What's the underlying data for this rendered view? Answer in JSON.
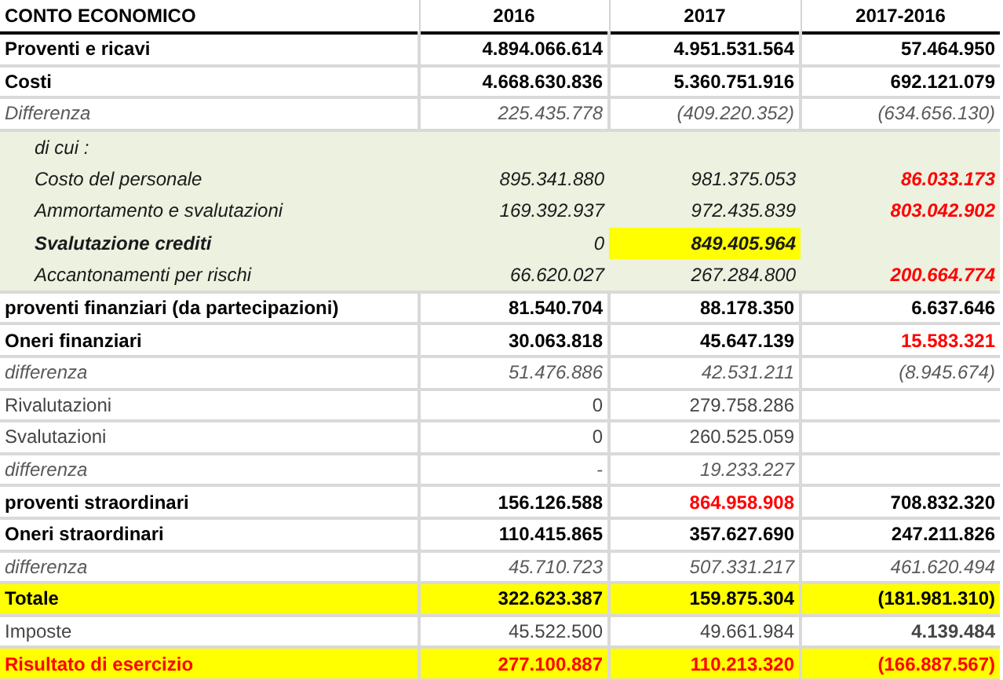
{
  "columns": [
    {
      "text": "CONTO ECONOMICO"
    },
    {
      "text": "2016"
    },
    {
      "text": "2017"
    },
    {
      "text": "2017-2016"
    }
  ],
  "rows": [
    {
      "kind": "main",
      "cells": [
        {
          "text": "Proventi e ricavi",
          "bold": true,
          "flagged": false,
          "highlighted": false
        },
        {
          "text": "4.894.066.614",
          "bold": true,
          "flagged": false,
          "highlighted": false
        },
        {
          "text": "4.951.531.564",
          "bold": true,
          "flagged": false,
          "highlighted": false
        },
        {
          "text": "57.464.950",
          "bold": true,
          "flagged": false,
          "highlighted": false
        }
      ]
    },
    {
      "kind": "main",
      "cells": [
        {
          "text": "Costi",
          "bold": true,
          "flagged": false,
          "highlighted": false
        },
        {
          "text": "4.668.630.836",
          "bold": true,
          "flagged": false,
          "highlighted": false
        },
        {
          "text": "5.360.751.916",
          "bold": true,
          "flagged": false,
          "highlighted": false
        },
        {
          "text": "692.121.079",
          "bold": true,
          "flagged": false,
          "highlighted": false
        }
      ]
    },
    {
      "kind": "diff",
      "cells": [
        {
          "text": "Differenza",
          "bold": false,
          "flagged": false,
          "highlighted": false
        },
        {
          "text": "225.435.778",
          "bold": false,
          "flagged": false,
          "highlighted": false
        },
        {
          "text": "(409.220.352)",
          "bold": false,
          "flagged": false,
          "highlighted": false
        },
        {
          "text": "(634.656.130)",
          "bold": false,
          "flagged": false,
          "highlighted": false
        }
      ]
    },
    {
      "kind": "sub",
      "cells": [
        {
          "text": "di cui :",
          "bold": false,
          "flagged": false,
          "highlighted": false
        },
        null,
        null,
        null
      ]
    },
    {
      "kind": "sub",
      "cells": [
        {
          "text": "Costo del personale",
          "bold": false,
          "flagged": false,
          "highlighted": false
        },
        {
          "text": "895.341.880",
          "bold": false,
          "flagged": false,
          "highlighted": false
        },
        {
          "text": "981.375.053",
          "bold": false,
          "flagged": false,
          "highlighted": false
        },
        {
          "text": "86.033.173",
          "bold": true,
          "flagged": true,
          "highlighted": false
        }
      ]
    },
    {
      "kind": "sub",
      "cells": [
        {
          "text": "Ammortamento e svalutazioni",
          "bold": false,
          "flagged": false,
          "highlighted": false
        },
        {
          "text": "169.392.937",
          "bold": false,
          "flagged": false,
          "highlighted": false
        },
        {
          "text": "972.435.839",
          "bold": false,
          "flagged": false,
          "highlighted": false
        },
        {
          "text": "803.042.902",
          "bold": true,
          "flagged": true,
          "highlighted": false
        }
      ]
    },
    {
      "kind": "sub",
      "cells": [
        {
          "text": "Svalutazione crediti",
          "bold": true,
          "flagged": false,
          "highlighted": false
        },
        {
          "text": "0",
          "bold": false,
          "flagged": false,
          "highlighted": false
        },
        {
          "text": "849.405.964",
          "bold": true,
          "flagged": false,
          "highlighted": true
        },
        null
      ]
    },
    {
      "kind": "sub",
      "cells": [
        {
          "text": "Accantonamenti per rischi",
          "bold": false,
          "flagged": false,
          "highlighted": false
        },
        {
          "text": "66.620.027",
          "bold": false,
          "flagged": false,
          "highlighted": false
        },
        {
          "text": "267.284.800",
          "bold": false,
          "flagged": false,
          "highlighted": false
        },
        {
          "text": "200.664.774",
          "bold": true,
          "flagged": true,
          "highlighted": false
        }
      ]
    },
    {
      "kind": "main",
      "cells": [
        {
          "text": "proventi finanziari (da partecipazioni)",
          "bold": true,
          "flagged": false,
          "highlighted": false
        },
        {
          "text": "81.540.704",
          "bold": true,
          "flagged": false,
          "highlighted": false
        },
        {
          "text": "88.178.350",
          "bold": true,
          "flagged": false,
          "highlighted": false
        },
        {
          "text": "6.637.646",
          "bold": true,
          "flagged": false,
          "highlighted": false
        }
      ]
    },
    {
      "kind": "main",
      "cells": [
        {
          "text": "Oneri finanziari",
          "bold": true,
          "flagged": false,
          "highlighted": false
        },
        {
          "text": "30.063.818",
          "bold": true,
          "flagged": false,
          "highlighted": false
        },
        {
          "text": "45.647.139",
          "bold": true,
          "flagged": false,
          "highlighted": false
        },
        {
          "text": "15.583.321",
          "bold": true,
          "flagged": true,
          "highlighted": false
        }
      ]
    },
    {
      "kind": "diff",
      "cells": [
        {
          "text": "differenza",
          "bold": false,
          "flagged": false,
          "highlighted": false
        },
        {
          "text": "51.476.886",
          "bold": false,
          "flagged": false,
          "highlighted": false
        },
        {
          "text": "42.531.211",
          "bold": false,
          "flagged": false,
          "highlighted": false
        },
        {
          "text": "(8.945.674)",
          "bold": false,
          "flagged": false,
          "highlighted": false
        }
      ]
    },
    {
      "kind": "plain",
      "cells": [
        {
          "text": "Rivalutazioni",
          "bold": false,
          "flagged": false,
          "highlighted": false
        },
        {
          "text": "0",
          "bold": false,
          "flagged": false,
          "highlighted": false
        },
        {
          "text": "279.758.286",
          "bold": false,
          "flagged": false,
          "highlighted": false
        },
        null
      ]
    },
    {
      "kind": "plain",
      "cells": [
        {
          "text": "Svalutazioni",
          "bold": false,
          "flagged": false,
          "highlighted": false
        },
        {
          "text": "0",
          "bold": false,
          "flagged": false,
          "highlighted": false
        },
        {
          "text": "260.525.059",
          "bold": false,
          "flagged": false,
          "highlighted": false
        },
        null
      ]
    },
    {
      "kind": "diff",
      "cells": [
        {
          "text": "differenza",
          "bold": false,
          "flagged": false,
          "highlighted": false
        },
        {
          "text": "-",
          "bold": false,
          "flagged": false,
          "highlighted": false
        },
        {
          "text": "19.233.227",
          "bold": false,
          "flagged": false,
          "highlighted": false
        },
        null
      ]
    },
    {
      "kind": "main",
      "cells": [
        {
          "text": "proventi straordinari",
          "bold": true,
          "flagged": false,
          "highlighted": false
        },
        {
          "text": "156.126.588",
          "bold": true,
          "flagged": false,
          "highlighted": false
        },
        {
          "text": "864.958.908",
          "bold": true,
          "flagged": true,
          "highlighted": false
        },
        {
          "text": "708.832.320",
          "bold": true,
          "flagged": false,
          "highlighted": false
        }
      ]
    },
    {
      "kind": "main",
      "cells": [
        {
          "text": "Oneri straordinari",
          "bold": true,
          "flagged": false,
          "highlighted": false
        },
        {
          "text": "110.415.865",
          "bold": true,
          "flagged": false,
          "highlighted": false
        },
        {
          "text": "357.627.690",
          "bold": true,
          "flagged": false,
          "highlighted": false
        },
        {
          "text": "247.211.826",
          "bold": true,
          "flagged": false,
          "highlighted": false
        }
      ]
    },
    {
      "kind": "diff",
      "cells": [
        {
          "text": "differenza",
          "bold": false,
          "flagged": false,
          "highlighted": false
        },
        {
          "text": "45.710.723",
          "bold": false,
          "flagged": false,
          "highlighted": false
        },
        {
          "text": "507.331.217",
          "bold": false,
          "flagged": false,
          "highlighted": false
        },
        {
          "text": "461.620.494",
          "bold": false,
          "flagged": false,
          "highlighted": false
        }
      ]
    },
    {
      "kind": "total",
      "cells": [
        {
          "text": "Totale",
          "bold": true,
          "flagged": false,
          "highlighted": true
        },
        {
          "text": "322.623.387",
          "bold": true,
          "flagged": false,
          "highlighted": true
        },
        {
          "text": "159.875.304",
          "bold": true,
          "flagged": false,
          "highlighted": true
        },
        {
          "text": "(181.981.310)",
          "bold": true,
          "flagged": false,
          "highlighted": true
        }
      ]
    },
    {
      "kind": "plain",
      "cells": [
        {
          "text": "Imposte",
          "bold": false,
          "flagged": false,
          "highlighted": false
        },
        {
          "text": "45.522.500",
          "bold": false,
          "flagged": false,
          "highlighted": false
        },
        {
          "text": "49.661.984",
          "bold": false,
          "flagged": false,
          "highlighted": false
        },
        {
          "text": "4.139.484",
          "bold": true,
          "flagged": false,
          "highlighted": false
        }
      ]
    },
    {
      "kind": "total",
      "cells": [
        {
          "text": "Risultato di esercizio",
          "bold": true,
          "flagged": true,
          "highlighted": true
        },
        {
          "text": "277.100.887",
          "bold": true,
          "flagged": true,
          "highlighted": true
        },
        {
          "text": "110.213.320",
          "bold": true,
          "flagged": true,
          "highlighted": true
        },
        {
          "text": "(166.887.567)",
          "bold": true,
          "flagged": true,
          "highlighted": true
        }
      ]
    }
  ]
}
